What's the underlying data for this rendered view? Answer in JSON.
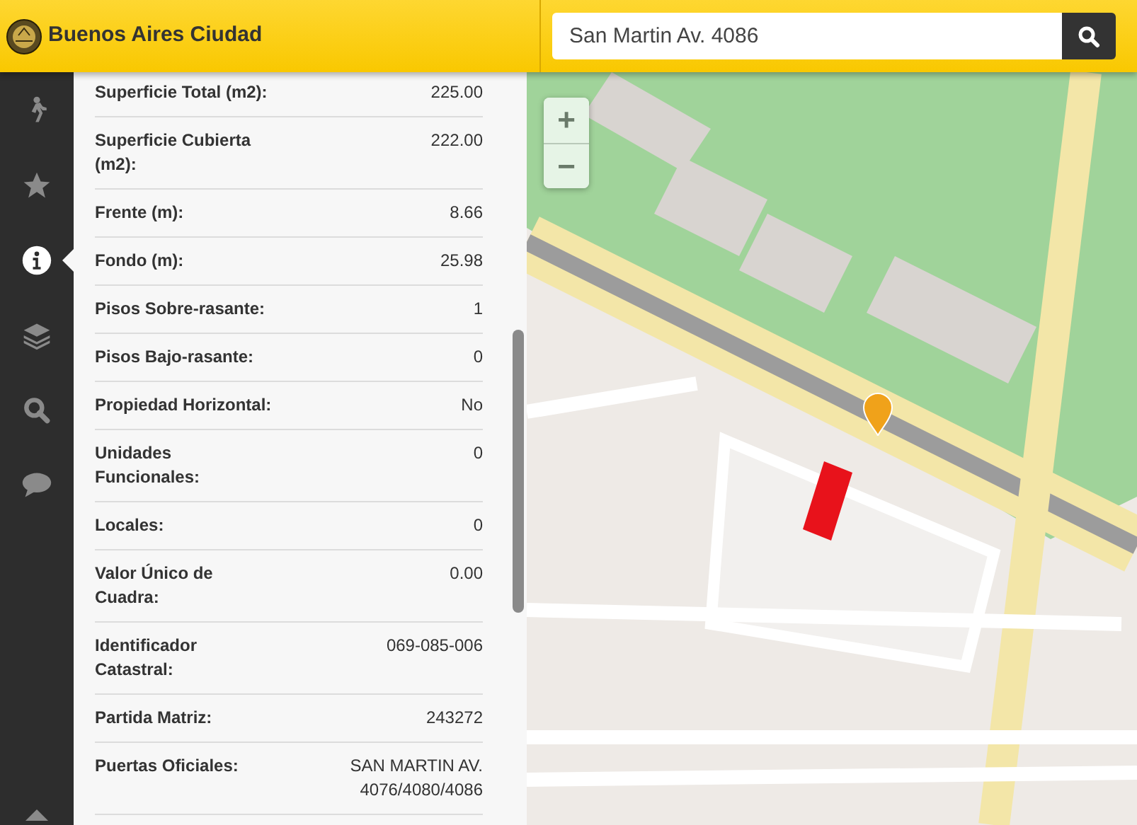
{
  "header": {
    "title": "Buenos Aires Ciudad",
    "search": {
      "value": "San Martin Av. 4086"
    }
  },
  "sidebar": {
    "items": [
      {
        "kind": "walker",
        "selected": false
      },
      {
        "kind": "star",
        "selected": false
      },
      {
        "kind": "info",
        "selected": true
      },
      {
        "kind": "layers",
        "selected": false
      },
      {
        "kind": "search",
        "selected": false
      },
      {
        "kind": "chat",
        "selected": false
      },
      {
        "kind": "caret",
        "selected": false
      }
    ]
  },
  "details": [
    {
      "label": "Superficie Total (m2):",
      "value": "225.00"
    },
    {
      "label": "Superficie Cubierta (m2):",
      "value": "222.00"
    },
    {
      "label": "Frente (m):",
      "value": "8.66"
    },
    {
      "label": "Fondo (m):",
      "value": "25.98"
    },
    {
      "label": "Pisos Sobre-rasante:",
      "value": "1"
    },
    {
      "label": "Pisos Bajo-rasante:",
      "value": "0"
    },
    {
      "label": "Propiedad Horizontal:",
      "value": "No"
    },
    {
      "label": "Unidades Funcionales:",
      "value": "0"
    },
    {
      "label": "Locales:",
      "value": "0"
    },
    {
      "label": "Valor Único de Cuadra:",
      "value": "0.00"
    },
    {
      "label": "Identificador Catastral:",
      "value": "069-085-006"
    },
    {
      "label": "Partida Matriz:",
      "value": "243272"
    },
    {
      "label": "Puertas Oficiales:",
      "value": "SAN MARTIN AV. 4076/4080/4086"
    }
  ],
  "map": {
    "zoom_in": "+",
    "zoom_out": "−"
  }
}
